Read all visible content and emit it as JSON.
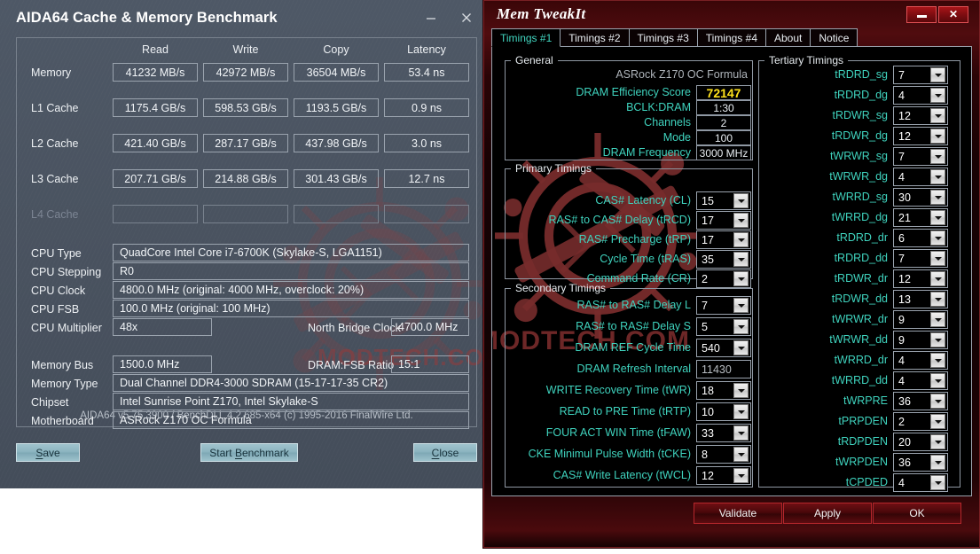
{
  "aida": {
    "title": "AIDA64 Cache & Memory Benchmark",
    "window_controls": {
      "minimize": "minimize-icon",
      "close": "close-icon"
    },
    "columns": [
      "Read",
      "Write",
      "Copy",
      "Latency"
    ],
    "bench_rows": [
      {
        "label": "Memory",
        "read": "41232 MB/s",
        "write": "42972 MB/s",
        "copy": "36504 MB/s",
        "latency": "53.4 ns"
      },
      {
        "label": "L1 Cache",
        "read": "1175.4 GB/s",
        "write": "598.53 GB/s",
        "copy": "1193.5 GB/s",
        "latency": "0.9 ns"
      },
      {
        "label": "L2 Cache",
        "read": "421.40 GB/s",
        "write": "287.17 GB/s",
        "copy": "437.98 GB/s",
        "latency": "3.0 ns"
      },
      {
        "label": "L3 Cache",
        "read": "207.71 GB/s",
        "write": "214.88 GB/s",
        "copy": "301.43 GB/s",
        "latency": "12.7 ns"
      },
      {
        "label": "L4 Cache",
        "read": "",
        "write": "",
        "copy": "",
        "latency": ""
      }
    ],
    "info": {
      "cpu_type_label": "CPU Type",
      "cpu_type_value": "QuadCore Intel Core i7-6700K  (Skylake-S, LGA1151)",
      "cpu_stepping_label": "CPU Stepping",
      "cpu_stepping_value": "R0",
      "cpu_clock_label": "CPU Clock",
      "cpu_clock_value": "4800.0 MHz  (original: 4000 MHz, overclock: 20%)",
      "cpu_fsb_label": "CPU FSB",
      "cpu_fsb_value": "100.0 MHz  (original: 100 MHz)",
      "cpu_multiplier_label": "CPU Multiplier",
      "cpu_multiplier_value": "48x",
      "north_bridge_label": "North Bridge Clock",
      "north_bridge_value": "4700.0 MHz",
      "memory_bus_label": "Memory Bus",
      "memory_bus_value": "1500.0 MHz",
      "dram_fsb_label": "DRAM:FSB Ratio",
      "dram_fsb_value": "15:1",
      "memory_type_label": "Memory Type",
      "memory_type_value": "Dual Channel DDR4-3000 SDRAM  (15-17-17-35 CR2)",
      "chipset_label": "Chipset",
      "chipset_value": "Intel Sunrise Point Z170, Intel Skylake-S",
      "motherboard_label": "Motherboard",
      "motherboard_value": "ASRock Z170 OC Formula"
    },
    "footer": "AIDA64 v5.75.3900 / BenchDLL 4.2.685-x64  (c) 1995-2016 FinalWire Ltd.",
    "buttons": {
      "save": "Save",
      "start": "Start Benchmark",
      "close": "Close"
    },
    "watermark_text": "MODTECH.COM"
  },
  "memtweakit": {
    "title": "Mem TweakIt",
    "window_controls": {
      "minimize": "minimize-icon",
      "close": "close-icon"
    },
    "tabs": [
      {
        "label": "Timings #1",
        "active": true
      },
      {
        "label": "Timings #2",
        "active": false
      },
      {
        "label": "Timings #3",
        "active": false
      },
      {
        "label": "Timings #4",
        "active": false
      },
      {
        "label": "About",
        "active": false
      },
      {
        "label": "Notice",
        "active": false
      }
    ],
    "general": {
      "legend": "General",
      "motherboard": "ASRock Z170 OC Formula",
      "rows": [
        {
          "label": "DRAM Efficiency Score",
          "value": "72147",
          "highlight": true
        },
        {
          "label": "BCLK:DRAM",
          "value": "1:30",
          "highlight": false
        },
        {
          "label": "Channels",
          "value": "2",
          "highlight": false
        },
        {
          "label": "Mode",
          "value": "100",
          "highlight": false
        },
        {
          "label": "DRAM Frequency",
          "value": "3000 MHz",
          "highlight": false
        }
      ]
    },
    "primary": {
      "legend": "Primary Timings",
      "rows": [
        {
          "label": "CAS# Latency (CL)",
          "value": "15"
        },
        {
          "label": "RAS# to CAS# Delay (tRCD)",
          "value": "17"
        },
        {
          "label": "RAS# Precharge (tRP)",
          "value": "17"
        },
        {
          "label": "Cycle Time (tRAS)",
          "value": "35"
        },
        {
          "label": "Command Rate (CR)",
          "value": "2"
        }
      ]
    },
    "secondary": {
      "legend": "Secondary Timings",
      "rows": [
        {
          "label": "RAS# to RAS# Delay L",
          "value": "7",
          "type": "combo"
        },
        {
          "label": "RAS# to RAS# Delay S",
          "value": "5",
          "type": "combo"
        },
        {
          "label": "DRAM REF Cycle Time",
          "value": "540",
          "type": "combo"
        },
        {
          "label": "DRAM Refresh Interval",
          "value": "11430",
          "type": "text"
        },
        {
          "label": "WRITE Recovery Time (tWR)",
          "value": "18",
          "type": "combo"
        },
        {
          "label": "READ to PRE Time (tRTP)",
          "value": "10",
          "type": "combo"
        },
        {
          "label": "FOUR ACT WIN Time (tFAW)",
          "value": "33",
          "type": "combo"
        },
        {
          "label": "CKE Minimul Pulse Width (tCKE)",
          "value": "8",
          "type": "combo"
        },
        {
          "label": "CAS# Write Latency (tWCL)",
          "value": "12",
          "type": "combo"
        }
      ]
    },
    "tertiary": {
      "legend": "Tertiary Timings",
      "rows": [
        {
          "label": "tRDRD_sg",
          "value": "7"
        },
        {
          "label": "tRDRD_dg",
          "value": "4"
        },
        {
          "label": "tRDWR_sg",
          "value": "12"
        },
        {
          "label": "tRDWR_dg",
          "value": "12"
        },
        {
          "label": "tWRWR_sg",
          "value": "7"
        },
        {
          "label": "tWRWR_dg",
          "value": "4"
        },
        {
          "label": "tWRRD_sg",
          "value": "30"
        },
        {
          "label": "tWRRD_dg",
          "value": "21"
        },
        {
          "label": "tRDRD_dr",
          "value": "6"
        },
        {
          "label": "tRDRD_dd",
          "value": "7"
        },
        {
          "label": "tRDWR_dr",
          "value": "12"
        },
        {
          "label": "tRDWR_dd",
          "value": "13"
        },
        {
          "label": "tWRWR_dr",
          "value": "9"
        },
        {
          "label": "tWRWR_dd",
          "value": "9"
        },
        {
          "label": "tWRRD_dr",
          "value": "4"
        },
        {
          "label": "tWRRD_dd",
          "value": "4"
        },
        {
          "label": "tWRPRE",
          "value": "36"
        },
        {
          "label": "tPRPDEN",
          "value": "2"
        },
        {
          "label": "tRDPDEN",
          "value": "20"
        },
        {
          "label": "tWRPDEN",
          "value": "36"
        },
        {
          "label": "tCPDED",
          "value": "4"
        }
      ]
    },
    "buttons": {
      "validate": "Validate",
      "apply": "Apply",
      "ok": "OK"
    }
  },
  "colors": {
    "aida_bg": "#49525f",
    "aida_accent": "#8bb3bf",
    "mtw_label": "#3fd3be",
    "mtw_score": "#ffe21c",
    "mtw_red": "#b5272c"
  }
}
